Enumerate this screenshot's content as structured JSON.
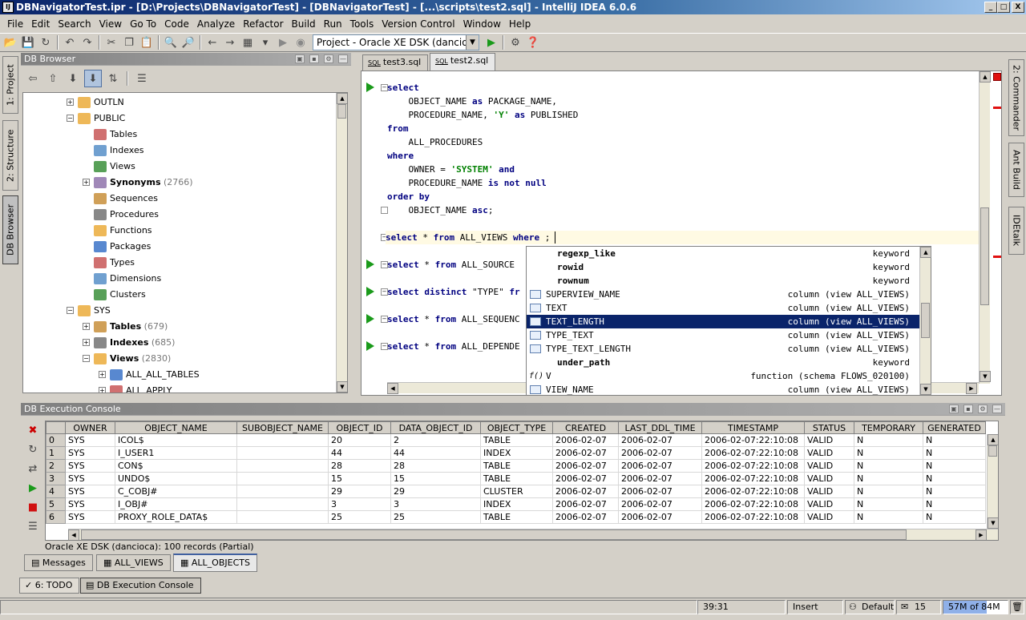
{
  "window": {
    "title": "DBNavigatorTest.ipr - [D:\\Projects\\DBNavigatorTest] - [DBNavigatorTest] - [...\\scripts\\test2.sql] - IntelliJ IDEA 6.0.6",
    "controls": [
      "_",
      "□",
      "X"
    ]
  },
  "menu": [
    "File",
    "Edit",
    "Search",
    "View",
    "Go To",
    "Code",
    "Analyze",
    "Refactor",
    "Build",
    "Run",
    "Tools",
    "Version Control",
    "Window",
    "Help"
  ],
  "toolbar": {
    "project_selector": "Project - Oracle XE DSK (dancioca)"
  },
  "left_tabs": [
    "1: Project",
    "2: Structure",
    "DB Browser"
  ],
  "right_tabs": [
    "2: Commander",
    "Ant Build",
    "IDEtalk"
  ],
  "db_browser": {
    "title": "DB Browser",
    "tree": [
      {
        "label": "OUTLN",
        "level": 3,
        "expander": "+",
        "bold": false,
        "count": ""
      },
      {
        "label": "PUBLIC",
        "level": 3,
        "expander": "−",
        "bold": false,
        "count": ""
      },
      {
        "label": "Tables",
        "level": 4,
        "expander": "",
        "bold": false,
        "count": ""
      },
      {
        "label": "Indexes",
        "level": 4,
        "expander": "",
        "bold": false,
        "count": ""
      },
      {
        "label": "Views",
        "level": 4,
        "expander": "",
        "bold": false,
        "count": ""
      },
      {
        "label": "Synonyms",
        "level": 4,
        "expander": "+",
        "bold": true,
        "count": "(2766)"
      },
      {
        "label": "Sequences",
        "level": 4,
        "expander": "",
        "bold": false,
        "count": ""
      },
      {
        "label": "Procedures",
        "level": 4,
        "expander": "",
        "bold": false,
        "count": ""
      },
      {
        "label": "Functions",
        "level": 4,
        "expander": "",
        "bold": false,
        "count": ""
      },
      {
        "label": "Packages",
        "level": 4,
        "expander": "",
        "bold": false,
        "count": ""
      },
      {
        "label": "Types",
        "level": 4,
        "expander": "",
        "bold": false,
        "count": ""
      },
      {
        "label": "Dimensions",
        "level": 4,
        "expander": "",
        "bold": false,
        "count": ""
      },
      {
        "label": "Clusters",
        "level": 4,
        "expander": "",
        "bold": false,
        "count": ""
      },
      {
        "label": "SYS",
        "level": 3,
        "expander": "−",
        "bold": false,
        "count": ""
      },
      {
        "label": "Tables",
        "level": 4,
        "expander": "+",
        "bold": true,
        "count": "(679)"
      },
      {
        "label": "Indexes",
        "level": 4,
        "expander": "+",
        "bold": true,
        "count": "(685)"
      },
      {
        "label": "Views",
        "level": 4,
        "expander": "−",
        "bold": true,
        "count": "(2830)"
      },
      {
        "label": "ALL_ALL_TABLES",
        "level": 5,
        "expander": "+",
        "bold": false,
        "count": ""
      },
      {
        "label": "ALL_APPLY",
        "level": 5,
        "expander": "+",
        "bold": false,
        "count": ""
      }
    ]
  },
  "editor": {
    "tabs": [
      {
        "label": "test3.sql",
        "prefix": "SQL",
        "selected": false
      },
      {
        "label": "test2.sql",
        "prefix": "SQL",
        "selected": true
      }
    ],
    "lines": [
      {
        "run": true,
        "fold": "−",
        "parts": [
          {
            "t": "select",
            "c": "kw"
          }
        ]
      },
      {
        "run": false,
        "fold": "",
        "parts": [
          {
            "t": "    OBJECT_NAME ",
            "c": ""
          },
          {
            "t": "as",
            "c": "kw"
          },
          {
            "t": " PACKAGE_NAME,",
            "c": ""
          }
        ]
      },
      {
        "run": false,
        "fold": "",
        "parts": [
          {
            "t": "    PROCEDURE_NAME, ",
            "c": ""
          },
          {
            "t": "'Y'",
            "c": "str"
          },
          {
            "t": " ",
            "c": ""
          },
          {
            "t": "as",
            "c": "kw"
          },
          {
            "t": " PUBLISHED",
            "c": ""
          }
        ]
      },
      {
        "run": false,
        "fold": "",
        "parts": [
          {
            "t": "from",
            "c": "kw"
          }
        ]
      },
      {
        "run": false,
        "fold": "",
        "parts": [
          {
            "t": "    ALL_PROCEDURES",
            "c": ""
          }
        ]
      },
      {
        "run": false,
        "fold": "",
        "parts": [
          {
            "t": "where",
            "c": "kw"
          }
        ]
      },
      {
        "run": false,
        "fold": "",
        "parts": [
          {
            "t": "    OWNER = ",
            "c": ""
          },
          {
            "t": "'SYSTEM'",
            "c": "str"
          },
          {
            "t": " ",
            "c": ""
          },
          {
            "t": "and",
            "c": "kw"
          }
        ]
      },
      {
        "run": false,
        "fold": "",
        "parts": [
          {
            "t": "    PROCEDURE_NAME ",
            "c": ""
          },
          {
            "t": "is not null",
            "c": "kw"
          }
        ]
      },
      {
        "run": false,
        "fold": "",
        "parts": [
          {
            "t": "order by",
            "c": "kw"
          }
        ]
      },
      {
        "run": false,
        "fold": "△",
        "parts": [
          {
            "t": "    OBJECT_NAME ",
            "c": ""
          },
          {
            "t": "asc",
            "c": "kw"
          },
          {
            "t": ";",
            "c": ""
          }
        ]
      },
      {
        "run": false,
        "fold": "",
        "parts": []
      },
      {
        "run": false,
        "fold": "−",
        "current": true,
        "parts": [
          {
            "t": "select",
            "c": "kw"
          },
          {
            "t": " * ",
            "c": ""
          },
          {
            "t": "from",
            "c": "kw"
          },
          {
            "t": " ALL_VIEWS ",
            "c": ""
          },
          {
            "t": "where",
            "c": "kw"
          },
          {
            "t": " ;",
            "c": ""
          }
        ]
      },
      {
        "run": false,
        "fold": "",
        "parts": []
      },
      {
        "run": true,
        "fold": "−",
        "parts": [
          {
            "t": "select",
            "c": "kw"
          },
          {
            "t": " * ",
            "c": ""
          },
          {
            "t": "from",
            "c": "kw"
          },
          {
            "t": " ALL_SOURCE",
            "c": ""
          }
        ]
      },
      {
        "run": false,
        "fold": "",
        "parts": []
      },
      {
        "run": true,
        "fold": "−",
        "parts": [
          {
            "t": "select distinct",
            "c": "kw"
          },
          {
            "t": " \"TYPE\" ",
            "c": ""
          },
          {
            "t": "fr",
            "c": "kw"
          }
        ]
      },
      {
        "run": false,
        "fold": "",
        "parts": []
      },
      {
        "run": true,
        "fold": "−",
        "parts": [
          {
            "t": "select",
            "c": "kw"
          },
          {
            "t": " * ",
            "c": ""
          },
          {
            "t": "from",
            "c": "kw"
          },
          {
            "t": " ALL_SEQUENC",
            "c": ""
          }
        ]
      },
      {
        "run": false,
        "fold": "",
        "parts": []
      },
      {
        "run": true,
        "fold": "−",
        "parts": [
          {
            "t": "select",
            "c": "kw"
          },
          {
            "t": " * ",
            "c": ""
          },
          {
            "t": "from",
            "c": "kw"
          },
          {
            "t": " ALL_DEPENDE",
            "c": ""
          }
        ]
      }
    ]
  },
  "completion": [
    {
      "name": "regexp_like",
      "type": "keyword",
      "icon": "",
      "selected": false
    },
    {
      "name": "rowid",
      "type": "keyword",
      "icon": "",
      "selected": false
    },
    {
      "name": "rownum",
      "type": "keyword",
      "icon": "",
      "selected": false
    },
    {
      "name": "SUPERVIEW_NAME",
      "type": "column (view ALL_VIEWS)",
      "icon": "column-icon",
      "selected": false
    },
    {
      "name": "TEXT",
      "type": "column (view ALL_VIEWS)",
      "icon": "column-icon",
      "selected": false
    },
    {
      "name": "TEXT_LENGTH",
      "type": "column (view ALL_VIEWS)",
      "icon": "column-icon",
      "selected": true
    },
    {
      "name": "TYPE_TEXT",
      "type": "column (view ALL_VIEWS)",
      "icon": "column-icon",
      "selected": false
    },
    {
      "name": "TYPE_TEXT_LENGTH",
      "type": "column (view ALL_VIEWS)",
      "icon": "column-icon",
      "selected": false
    },
    {
      "name": "under_path",
      "type": "keyword",
      "icon": "",
      "selected": false
    },
    {
      "name": "V",
      "type": "function (schema FLOWS_020100)",
      "icon": "function-icon",
      "selected": false
    },
    {
      "name": "VIEW_NAME",
      "type": "column (view ALL_VIEWS)",
      "icon": "column-icon",
      "selected": false
    }
  ],
  "console": {
    "title": "DB Execution Console",
    "columns": [
      "",
      "OWNER",
      "OBJECT_NAME",
      "SUBOBJECT_NAME",
      "OBJECT_ID",
      "DATA_OBJECT_ID",
      "OBJECT_TYPE",
      "CREATED",
      "LAST_DDL_TIME",
      "TIMESTAMP",
      "STATUS",
      "TEMPORARY",
      "GENERATED"
    ],
    "rows": [
      [
        "0",
        "SYS",
        "ICOL$",
        "",
        "20",
        "2",
        "TABLE",
        "2006-02-07",
        "2006-02-07",
        "2006-02-07:22:10:08",
        "VALID",
        "N",
        "N"
      ],
      [
        "1",
        "SYS",
        "I_USER1",
        "",
        "44",
        "44",
        "INDEX",
        "2006-02-07",
        "2006-02-07",
        "2006-02-07:22:10:08",
        "VALID",
        "N",
        "N"
      ],
      [
        "2",
        "SYS",
        "CON$",
        "",
        "28",
        "28",
        "TABLE",
        "2006-02-07",
        "2006-02-07",
        "2006-02-07:22:10:08",
        "VALID",
        "N",
        "N"
      ],
      [
        "3",
        "SYS",
        "UNDO$",
        "",
        "15",
        "15",
        "TABLE",
        "2006-02-07",
        "2006-02-07",
        "2006-02-07:22:10:08",
        "VALID",
        "N",
        "N"
      ],
      [
        "4",
        "SYS",
        "C_COBJ#",
        "",
        "29",
        "29",
        "CLUSTER",
        "2006-02-07",
        "2006-02-07",
        "2006-02-07:22:10:08",
        "VALID",
        "N",
        "N"
      ],
      [
        "5",
        "SYS",
        "I_OBJ#",
        "",
        "3",
        "3",
        "INDEX",
        "2006-02-07",
        "2006-02-07",
        "2006-02-07:22:10:08",
        "VALID",
        "N",
        "N"
      ],
      [
        "6",
        "SYS",
        "PROXY_ROLE_DATA$",
        "",
        "25",
        "25",
        "TABLE",
        "2006-02-07",
        "2006-02-07",
        "2006-02-07:22:10:08",
        "VALID",
        "N",
        "N"
      ]
    ],
    "status": "Oracle XE DSK (dancioca): 100 records (Partial)",
    "tabs": [
      {
        "label": "Messages",
        "selected": false
      },
      {
        "label": "ALL_VIEWS",
        "selected": false
      },
      {
        "label": "ALL_OBJECTS",
        "selected": true
      }
    ]
  },
  "bottom_tools": [
    {
      "label": "6: TODO",
      "selected": false
    },
    {
      "label": "DB Execution Console",
      "selected": true
    }
  ],
  "statusbar": {
    "position": "39:31",
    "mode": "Insert",
    "profile": "Default",
    "messages": "15",
    "memory": "57M of 84M",
    "memory_fraction": 0.68
  }
}
